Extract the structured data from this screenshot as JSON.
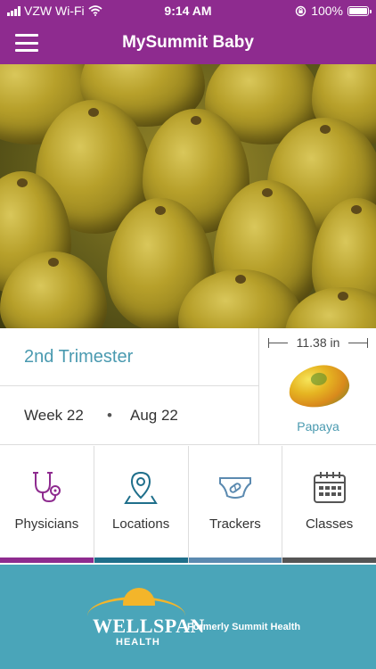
{
  "status_bar": {
    "carrier": "VZW Wi-Fi",
    "time": "9:14 AM",
    "battery_percent": "100%"
  },
  "app_bar": {
    "title": "MySummit Baby"
  },
  "info": {
    "trimester": "2nd Trimester",
    "week": "Week 22",
    "separator": "•",
    "date": "Aug 22",
    "size": "11.38 in",
    "fruit_label": "Papaya"
  },
  "nav": {
    "items": [
      {
        "label": "Physicians",
        "icon": "stethoscope-icon",
        "color": "#8e2b8f"
      },
      {
        "label": "Locations",
        "icon": "location-pin-icon",
        "color": "#1f6f8b"
      },
      {
        "label": "Trackers",
        "icon": "diaper-icon",
        "color": "#5b8ab0"
      },
      {
        "label": "Classes",
        "icon": "calendar-icon",
        "color": "#555555"
      }
    ]
  },
  "footer": {
    "brand": "WELLSPAN",
    "brand_sub": "HEALTH",
    "note": "Formerly Summit Health"
  },
  "colors": {
    "primary": "#8e2b8f",
    "accent": "#4a9ab0",
    "footer": "#4aa5b9"
  }
}
